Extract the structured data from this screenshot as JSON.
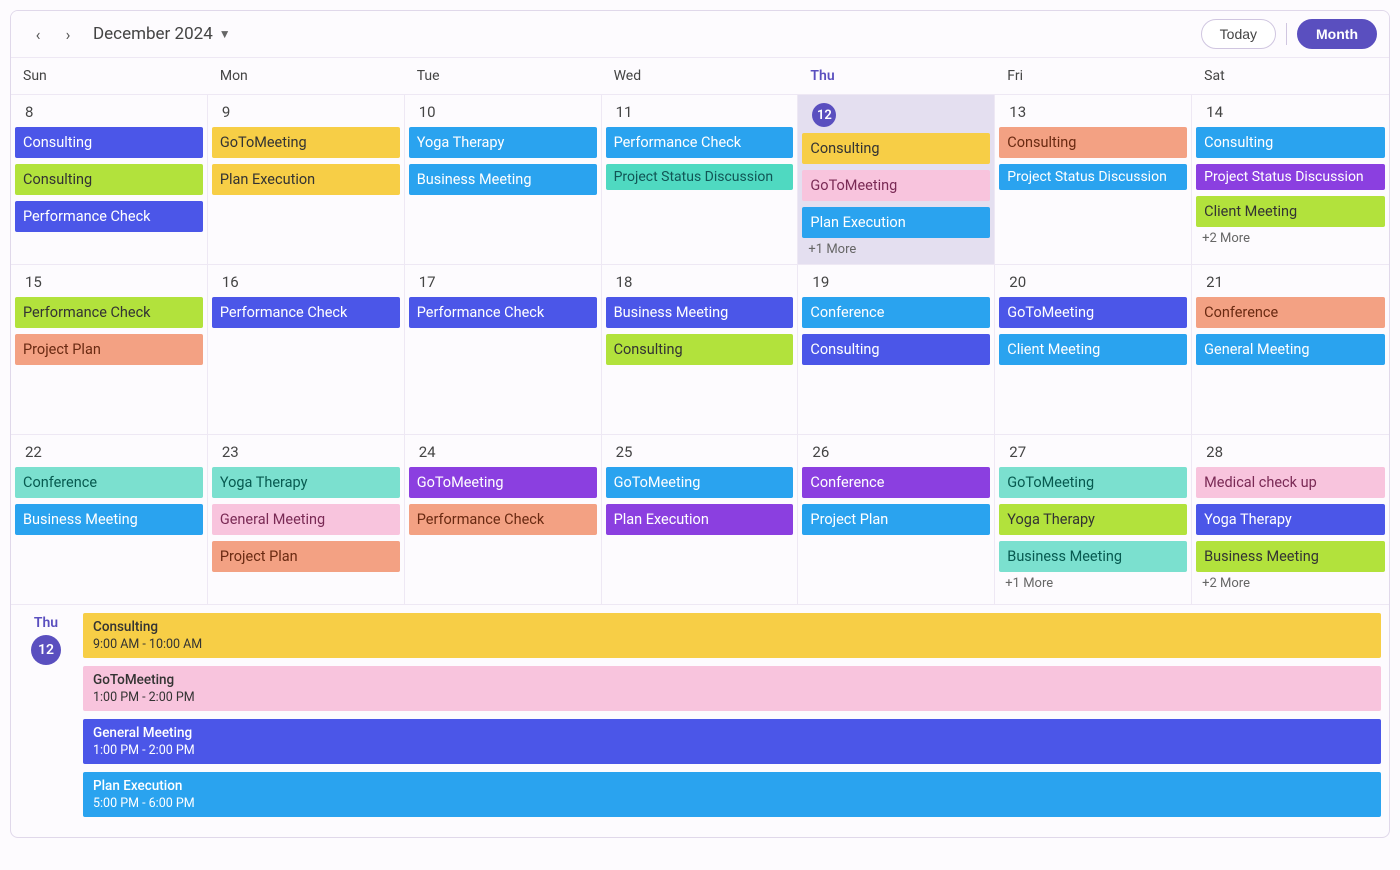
{
  "toolbar": {
    "month_label": "December 2024",
    "today_label": "Today",
    "view_label": "Month"
  },
  "dow": [
    "Sun",
    "Mon",
    "Tue",
    "Wed",
    "Thu",
    "Fri",
    "Sat"
  ],
  "today_index": 4,
  "weeks": [
    {
      "days": [
        {
          "n": "8",
          "today": false,
          "events": [
            {
              "t": "Consulting",
              "c": "c-blue"
            },
            {
              "t": "Consulting",
              "c": "c-lime"
            },
            {
              "t": "Performance Check",
              "c": "c-blue"
            }
          ]
        },
        {
          "n": "9",
          "today": false,
          "events": [
            {
              "t": "GoToMeeting",
              "c": "c-yellow"
            },
            {
              "t": "Plan Execution",
              "c": "c-yellow"
            }
          ]
        },
        {
          "n": "10",
          "today": false,
          "events": [
            {
              "t": "Yoga Therapy",
              "c": "c-sky"
            },
            {
              "t": "Business Meeting",
              "c": "c-sky"
            }
          ]
        },
        {
          "n": "11",
          "today": false,
          "events": [
            {
              "t": "Performance Check",
              "c": "c-sky"
            },
            {
              "t": "Project Status Discussion",
              "c": "c-teal",
              "multi": true
            }
          ]
        },
        {
          "n": "12",
          "today": true,
          "events": [
            {
              "t": "Consulting",
              "c": "c-yellow"
            },
            {
              "t": "GoToMeeting",
              "c": "c-ltpink"
            },
            {
              "t": "Plan Execution",
              "c": "c-sky"
            }
          ],
          "more": "+1 More"
        },
        {
          "n": "13",
          "today": false,
          "events": [
            {
              "t": "Consulting",
              "c": "c-salmon"
            },
            {
              "t": "Project Status Discussion",
              "c": "c-sky",
              "multi": true
            }
          ]
        },
        {
          "n": "14",
          "today": false,
          "events": [
            {
              "t": "Consulting",
              "c": "c-sky"
            },
            {
              "t": "Project Status Discussion",
              "c": "c-purple",
              "multi": true
            },
            {
              "t": "Client Meeting",
              "c": "c-lime"
            }
          ],
          "more": "+2 More"
        }
      ]
    },
    {
      "days": [
        {
          "n": "15",
          "today": false,
          "events": [
            {
              "t": "Performance Check",
              "c": "c-lime"
            },
            {
              "t": "Project Plan",
              "c": "c-salmon"
            }
          ]
        },
        {
          "n": "16",
          "today": false,
          "events": [
            {
              "t": "Performance Check",
              "c": "c-blue"
            }
          ]
        },
        {
          "n": "17",
          "today": false,
          "events": [
            {
              "t": "Performance Check",
              "c": "c-blue"
            }
          ]
        },
        {
          "n": "18",
          "today": false,
          "events": [
            {
              "t": "Business Meeting",
              "c": "c-blue"
            },
            {
              "t": "Consulting",
              "c": "c-lime"
            }
          ]
        },
        {
          "n": "19",
          "today": false,
          "events": [
            {
              "t": "Conference",
              "c": "c-sky"
            },
            {
              "t": "Consulting",
              "c": "c-blue"
            }
          ]
        },
        {
          "n": "20",
          "today": false,
          "events": [
            {
              "t": "GoToMeeting",
              "c": "c-blue"
            },
            {
              "t": "Client Meeting",
              "c": "c-sky"
            }
          ]
        },
        {
          "n": "21",
          "today": false,
          "events": [
            {
              "t": "Conference",
              "c": "c-salmon"
            },
            {
              "t": "General Meeting",
              "c": "c-sky"
            }
          ]
        }
      ]
    },
    {
      "days": [
        {
          "n": "22",
          "today": false,
          "events": [
            {
              "t": "Conference",
              "c": "c-mint"
            },
            {
              "t": "Business Meeting",
              "c": "c-sky"
            }
          ]
        },
        {
          "n": "23",
          "today": false,
          "events": [
            {
              "t": "Yoga Therapy",
              "c": "c-mint"
            },
            {
              "t": "General Meeting",
              "c": "c-ltpink"
            },
            {
              "t": "Project Plan",
              "c": "c-salmon"
            }
          ]
        },
        {
          "n": "24",
          "today": false,
          "events": [
            {
              "t": "GoToMeeting",
              "c": "c-purple"
            },
            {
              "t": "Performance Check",
              "c": "c-salmon"
            }
          ]
        },
        {
          "n": "25",
          "today": false,
          "events": [
            {
              "t": "GoToMeeting",
              "c": "c-sky"
            },
            {
              "t": "Plan Execution",
              "c": "c-purple"
            }
          ]
        },
        {
          "n": "26",
          "today": false,
          "events": [
            {
              "t": "Conference",
              "c": "c-purple"
            },
            {
              "t": "Project Plan",
              "c": "c-sky"
            }
          ]
        },
        {
          "n": "27",
          "today": false,
          "events": [
            {
              "t": "GoToMeeting",
              "c": "c-mint"
            },
            {
              "t": "Yoga Therapy",
              "c": "c-lime"
            },
            {
              "t": "Business Meeting",
              "c": "c-mint"
            }
          ],
          "more": "+1 More"
        },
        {
          "n": "28",
          "today": false,
          "events": [
            {
              "t": "Medical check up",
              "c": "c-ltpink"
            },
            {
              "t": "Yoga Therapy",
              "c": "c-blue"
            },
            {
              "t": "Business Meeting",
              "c": "c-lime"
            }
          ],
          "more": "+2 More"
        }
      ]
    }
  ],
  "agenda": {
    "day_name": "Thu",
    "day_num": "12",
    "items": [
      {
        "t": "Consulting",
        "s": "9:00 AM - 10:00 AM",
        "c": "c-yellow",
        "dark": true
      },
      {
        "t": "GoToMeeting",
        "s": "1:00 PM - 2:00 PM",
        "c": "c-ltpink",
        "dark": true
      },
      {
        "t": "General Meeting",
        "s": "1:00 PM - 2:00 PM",
        "c": "c-blue",
        "dark": false
      },
      {
        "t": "Plan Execution",
        "s": "5:00 PM - 6:00 PM",
        "c": "c-sky",
        "dark": false
      }
    ]
  }
}
